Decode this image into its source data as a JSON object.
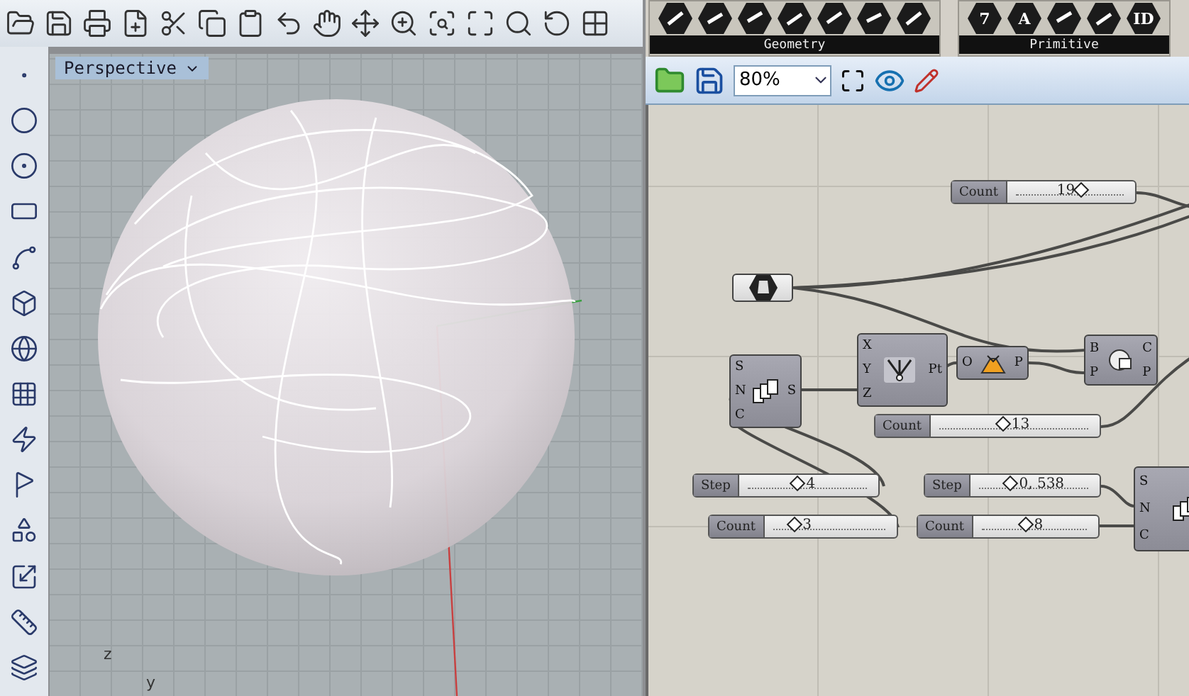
{
  "rhino": {
    "viewport": {
      "title": "Perspective",
      "axis_labels": [
        "z",
        "y"
      ]
    }
  },
  "grasshopper": {
    "ribbon_groups": [
      {
        "label": "Geometry",
        "items": [
          {
            "kind": "icon"
          },
          {
            "kind": "icon"
          },
          {
            "kind": "icon"
          },
          {
            "kind": "icon"
          },
          {
            "kind": "icon"
          },
          {
            "kind": "icon"
          },
          {
            "kind": "icon"
          }
        ]
      },
      {
        "label": "Primitive",
        "items": [
          {
            "kind": "glyph",
            "text": "7"
          },
          {
            "kind": "glyph",
            "text": "A"
          },
          {
            "kind": "icon"
          },
          {
            "kind": "icon"
          },
          {
            "kind": "glyph",
            "text": "ID"
          }
        ]
      }
    ],
    "zoom": "80%",
    "canvas": {
      "sliders": [
        {
          "label": "Count",
          "value": "19",
          "level": 0.61
        },
        {
          "label": "Count",
          "value": "13",
          "level": 0.43
        },
        {
          "label": "Step",
          "value": "4",
          "level": 0.42
        },
        {
          "label": "Count",
          "value": "3",
          "level": 0.19
        },
        {
          "label": "Step",
          "value": "0, 538",
          "level": 0.29
        },
        {
          "label": "Count",
          "value": "8",
          "level": 0.42
        }
      ],
      "components": [
        {
          "kind": "param"
        },
        {
          "kind": "series",
          "inputs": [
            "S",
            "N",
            "C"
          ],
          "outputs": [
            "S"
          ]
        },
        {
          "kind": "point",
          "inputs": [
            "X",
            "Y",
            "Z"
          ],
          "outputs": [
            "Pt"
          ]
        },
        {
          "kind": "plane",
          "inputs": [
            "O"
          ],
          "outputs": [
            "P"
          ]
        },
        {
          "kind": "section",
          "inputs": [
            "B",
            "P"
          ],
          "outputs": [
            "C",
            "P"
          ]
        },
        {
          "kind": "series",
          "inputs": [
            "S",
            "N",
            "C"
          ]
        }
      ]
    }
  }
}
